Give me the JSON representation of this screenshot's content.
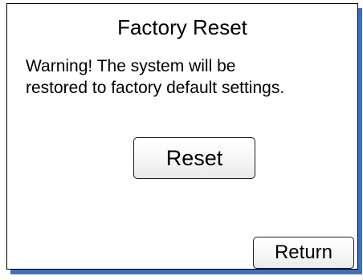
{
  "dialog": {
    "title": "Factory Reset",
    "warning_lines": [
      "Warning! The system will be",
      "restored to factory default settings."
    ],
    "reset_label": "Reset",
    "return_label": "Return"
  },
  "colors": {
    "background": "#ffffff",
    "border": "#000000",
    "shadow_accent": "#3f6fc0",
    "button_fill": "#f4f4f4"
  }
}
